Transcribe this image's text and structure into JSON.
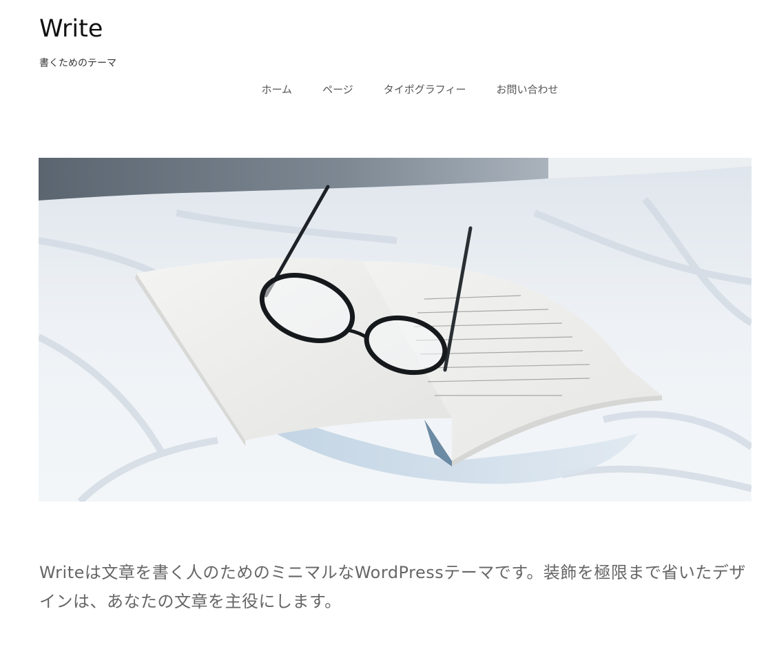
{
  "site": {
    "title": "Write",
    "description": "書くためのテーマ"
  },
  "nav": {
    "items": [
      {
        "label": "ホーム"
      },
      {
        "label": "ページ"
      },
      {
        "label": "タイポグラフィー"
      },
      {
        "label": "お問い合わせ"
      }
    ]
  },
  "hero": {
    "image_name": "open-book-with-glasses-on-bed"
  },
  "intro": {
    "text": "Writeは文章を書く人のためのミニマルなWordPressテーマです。装飾を極限まで省いたデザインは、あなたの文章を主役にします。"
  },
  "colors": {
    "text": "#333333",
    "nav_text": "#555555",
    "intro_text": "#666666",
    "background": "#ffffff"
  }
}
